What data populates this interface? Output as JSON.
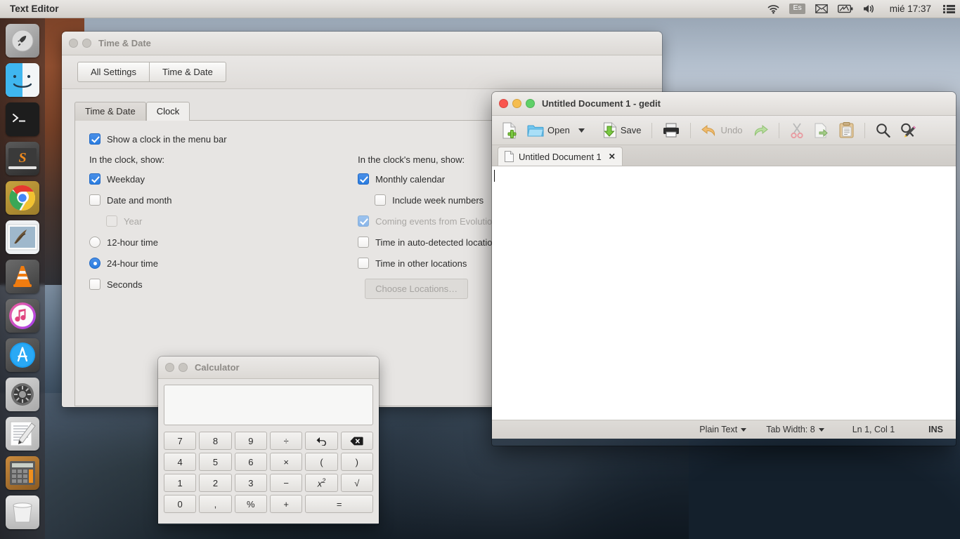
{
  "menubar": {
    "app_title": "Text Editor",
    "tray": {
      "wifi_icon": "wifi-icon",
      "keyboard_layout": "Es",
      "mail_icon": "mail-icon",
      "battery_icon": "battery-icon",
      "volume_icon": "volume-icon",
      "clock": "mié 17:37",
      "menu_icon": "hamburger-menu-icon"
    }
  },
  "launcher": {
    "items": [
      {
        "name": "launcher-item-launchpad",
        "icon": "rocket-icon",
        "running": false
      },
      {
        "name": "launcher-item-finder",
        "icon": "finder-face-icon",
        "running": false
      },
      {
        "name": "launcher-item-terminal",
        "icon": "terminal-icon",
        "running": false
      },
      {
        "name": "launcher-item-sublime-text",
        "icon": "sublime-s-icon",
        "running": false
      },
      {
        "name": "launcher-item-google-chrome",
        "icon": "chrome-icon",
        "running": true
      },
      {
        "name": "launcher-item-mail",
        "icon": "stamp-mail-icon",
        "running": false
      },
      {
        "name": "launcher-item-vlc",
        "icon": "vlc-cone-icon",
        "running": false
      },
      {
        "name": "launcher-item-itunes",
        "icon": "music-note-icon",
        "running": false
      },
      {
        "name": "launcher-item-app-store",
        "icon": "app-store-a-icon",
        "running": false
      },
      {
        "name": "launcher-item-system-preferences",
        "icon": "gear-icon",
        "running": true
      },
      {
        "name": "launcher-item-text-editor",
        "icon": "notepad-pencil-icon",
        "running": true
      },
      {
        "name": "launcher-item-calculator",
        "icon": "calculator-icon",
        "running": true
      },
      {
        "name": "launcher-item-trash",
        "icon": "trash-bin-icon",
        "running": false
      }
    ]
  },
  "timedate_window": {
    "title": "Time & Date",
    "toolbar": {
      "all_settings_label": "All Settings",
      "time_date_label": "Time & Date"
    },
    "tabs": [
      {
        "label": "Time & Date",
        "active": false
      },
      {
        "label": "Clock",
        "active": true
      }
    ],
    "show_clock": {
      "label": "Show a clock in the menu bar",
      "checked": true
    },
    "left_column": {
      "heading": "In the clock, show:",
      "options": [
        {
          "label": "Weekday",
          "type": "checkbox",
          "checked": true,
          "disabled": false,
          "indent": false
        },
        {
          "label": "Date and month",
          "type": "checkbox",
          "checked": false,
          "disabled": false,
          "indent": false
        },
        {
          "label": "Year",
          "type": "checkbox",
          "checked": false,
          "disabled": true,
          "indent": true
        },
        {
          "label": "12-hour time",
          "type": "radio",
          "checked": false,
          "disabled": false,
          "indent": false
        },
        {
          "label": "24-hour time",
          "type": "radio",
          "checked": true,
          "disabled": false,
          "indent": false
        },
        {
          "label": "Seconds",
          "type": "checkbox",
          "checked": false,
          "disabled": false,
          "indent": false
        }
      ]
    },
    "right_column": {
      "heading": "In the clock's menu, show:",
      "options": [
        {
          "label": "Monthly calendar",
          "type": "checkbox",
          "checked": true,
          "disabled": false,
          "indent": false
        },
        {
          "label": "Include week numbers",
          "type": "checkbox",
          "checked": false,
          "disabled": false,
          "indent": true
        },
        {
          "label": "Coming events from Evolution",
          "type": "checkbox",
          "checked": true,
          "disabled": true,
          "indent": false
        },
        {
          "label": "Time in auto-detected location",
          "type": "checkbox",
          "checked": false,
          "disabled": false,
          "indent": false
        },
        {
          "label": "Time in other locations",
          "type": "checkbox",
          "checked": false,
          "disabled": false,
          "indent": false
        }
      ],
      "choose_locations_label": "Choose Locations…"
    }
  },
  "gedit_window": {
    "title": "Untitled Document 1 - gedit",
    "toolbar": {
      "new_label": "",
      "open_label": "Open",
      "save_label": "Save",
      "print_label": "",
      "undo_label": "Undo",
      "redo_label": ""
    },
    "tab": {
      "label": "Untitled Document 1",
      "close_label": "✕"
    },
    "document_text": "",
    "status": {
      "language": "Plain Text",
      "tab_width": "Tab Width: 8",
      "cursor_position": "Ln 1, Col 1",
      "insert_mode": "INS"
    }
  },
  "calculator_window": {
    "title": "Calculator",
    "display_value": "",
    "keys": [
      {
        "label": "7",
        "name": "calc-key-7"
      },
      {
        "label": "8",
        "name": "calc-key-8"
      },
      {
        "label": "9",
        "name": "calc-key-9"
      },
      {
        "label": "÷",
        "name": "calc-key-divide"
      },
      {
        "label": "↶",
        "name": "calc-key-undo"
      },
      {
        "label": "⌫",
        "name": "calc-key-backspace"
      },
      {
        "label": "4",
        "name": "calc-key-4"
      },
      {
        "label": "5",
        "name": "calc-key-5"
      },
      {
        "label": "6",
        "name": "calc-key-6"
      },
      {
        "label": "×",
        "name": "calc-key-multiply"
      },
      {
        "label": "(",
        "name": "calc-key-open-paren"
      },
      {
        "label": ")",
        "name": "calc-key-close-paren"
      },
      {
        "label": "1",
        "name": "calc-key-1"
      },
      {
        "label": "2",
        "name": "calc-key-2"
      },
      {
        "label": "3",
        "name": "calc-key-3"
      },
      {
        "label": "−",
        "name": "calc-key-subtract"
      },
      {
        "label": "x²",
        "name": "calc-key-square"
      },
      {
        "label": "√",
        "name": "calc-key-sqrt"
      },
      {
        "label": "0",
        "name": "calc-key-0"
      },
      {
        "label": ",",
        "name": "calc-key-decimal"
      },
      {
        "label": "%",
        "name": "calc-key-percent"
      },
      {
        "label": "+",
        "name": "calc-key-add"
      },
      {
        "label": "=",
        "name": "calc-key-equals",
        "wide": true
      }
    ]
  },
  "colors": {
    "accent_blue": "#2b7de0",
    "window_bg": "#e4e2e0",
    "titlebar": "#e6e3e0",
    "close_red": "#f9564f",
    "min_yellow": "#f5bd4f",
    "max_green": "#5fd068"
  }
}
